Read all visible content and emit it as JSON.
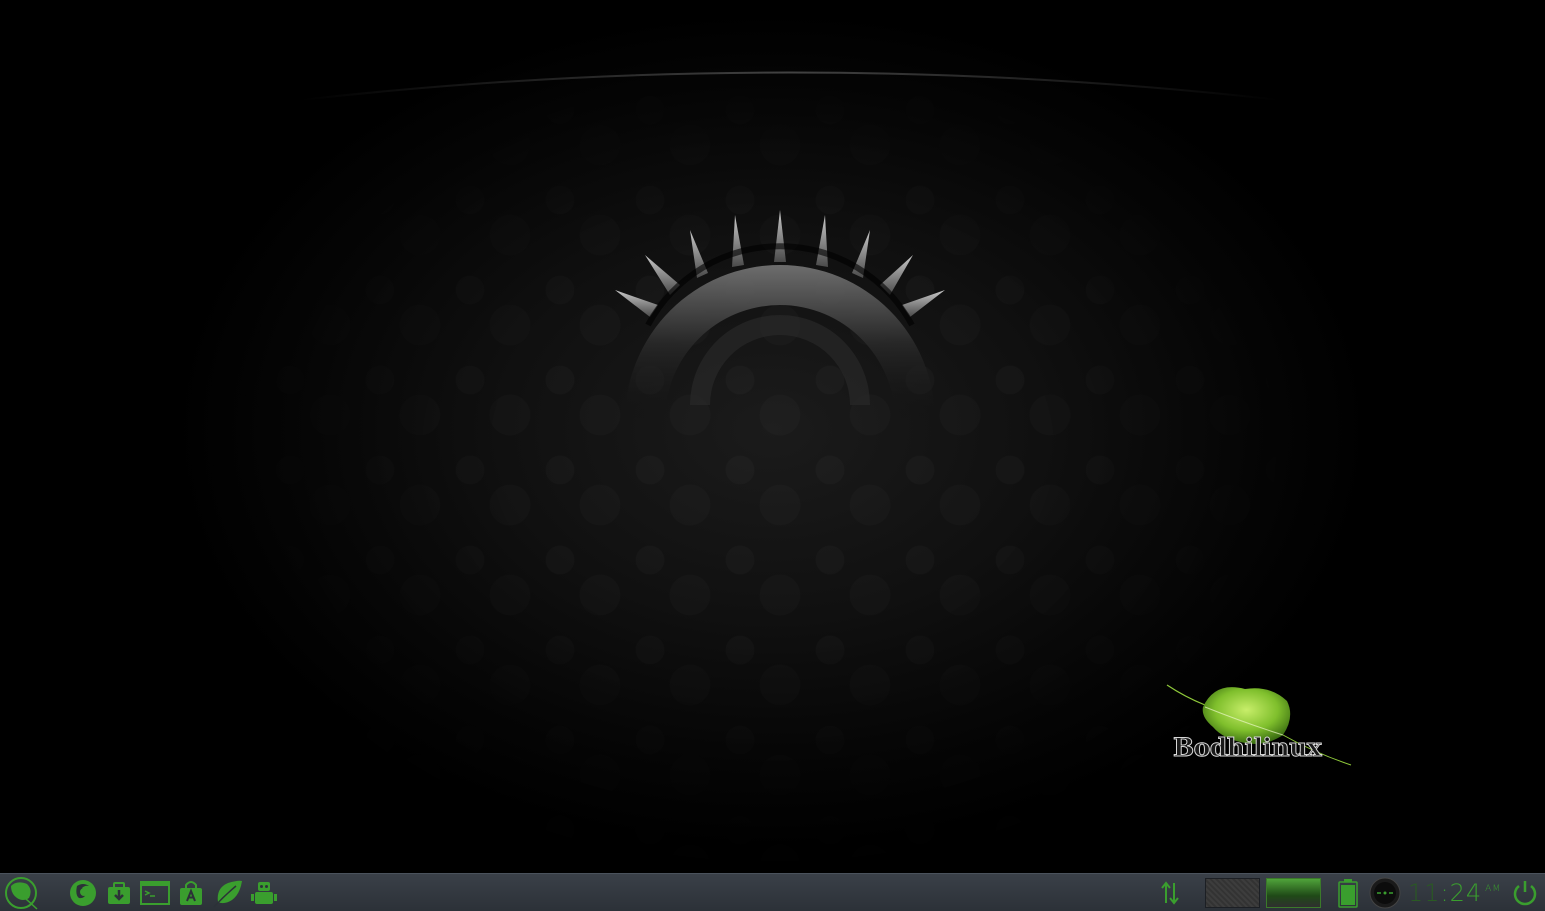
{
  "desktop": {
    "wallpaper_brand": "Bodhilinux"
  },
  "taskbar": {
    "start_button": {
      "icon": "bodhi-leaf-menu-icon"
    },
    "launchers": [
      {
        "name": "web-browser",
        "icon": "firefox-icon"
      },
      {
        "name": "software-installer",
        "icon": "package-download-icon"
      },
      {
        "name": "terminal",
        "icon": "terminal-icon"
      },
      {
        "name": "app-center",
        "icon": "app-store-bag-icon"
      },
      {
        "name": "bodhi-leaf",
        "icon": "leaf-icon"
      },
      {
        "name": "settings-robot",
        "icon": "robot-icon"
      }
    ],
    "tray": {
      "network_icon": "network-transfer-icon",
      "pager_desks": 2,
      "active_desk": 2,
      "battery_icon": "battery-icon",
      "mixer_icon": "sound-mixer-icon",
      "clock": {
        "hours": "11",
        "time_rest": ":24",
        "ampm": "AM"
      },
      "power_icon": "power-icon"
    }
  },
  "colors": {
    "accent": "#3a9e2e",
    "taskbar": "#33383f",
    "leaf": "#6fb82e"
  }
}
